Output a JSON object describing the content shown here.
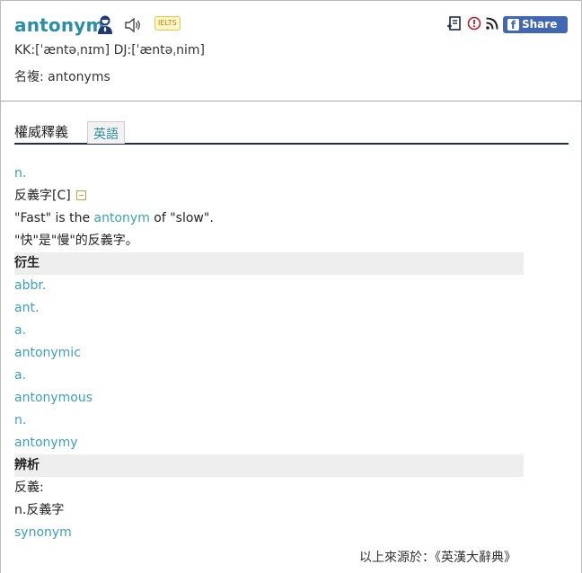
{
  "header": {
    "word": "antonym",
    "ielts_badge": "IELTS",
    "pronunciation": "KK:[ˈæntəˌnɪm] DJ:[ˈæntəˌnim]",
    "plural": "名複: antonyms",
    "share_label": "Share 0",
    "fb_glyph": "f",
    "icons": [
      "person-icon",
      "speaker-icon",
      "wordbook-icon",
      "report-icon",
      "rss-icon",
      "facebook-icon"
    ]
  },
  "tabs": {
    "main": "權威釋義",
    "english": "英語"
  },
  "definition": {
    "pos": "n.",
    "meaning": "反義字[C]",
    "example_before": "\"Fast\" is the ",
    "example_word": "antonym",
    "example_after": " of \"slow\".",
    "example_translation": "\"快\"是\"慢\"的反義字。"
  },
  "derivatives": {
    "heading": "衍生",
    "items": [
      "abbr.",
      "ant.",
      "a.",
      "antonymic",
      "a.",
      "antonymous",
      "n.",
      "antonymy"
    ]
  },
  "analysis": {
    "heading": "辨析",
    "label": "反義:",
    "pos_meaning": "n.反義字",
    "word": "synonym"
  },
  "source": "以上來源於：《英漢大辭典》",
  "colors": {
    "link": "#3aa0bb",
    "title": "#2d8fa6",
    "tab_underline": "#1c2d5a",
    "facebook": "#4267b2"
  }
}
